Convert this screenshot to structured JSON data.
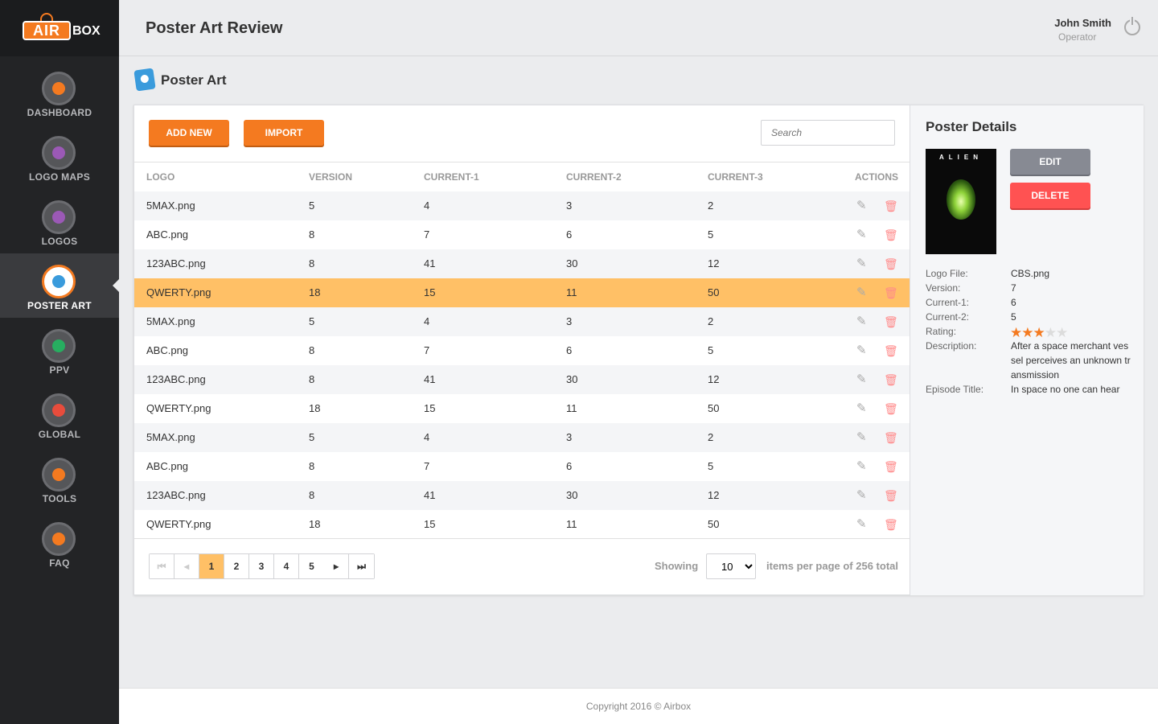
{
  "brand": {
    "air": "AIR",
    "box": "BOX"
  },
  "sidebar": {
    "items": [
      {
        "label": "DASHBOARD",
        "icon": "dashboard-gauge-icon",
        "color": "#f47a20"
      },
      {
        "label": "LOGO MAPS",
        "icon": "map-pin-icon",
        "color": "#9b59b6"
      },
      {
        "label": "LOGOS",
        "icon": "logo-swirl-icon",
        "color": "#9b59b6"
      },
      {
        "label": "POSTER ART",
        "icon": "poster-play-icon",
        "color": "#3a9bdc",
        "active": true
      },
      {
        "label": "PPV",
        "icon": "ppv-dollar-icon",
        "color": "#27ae60"
      },
      {
        "label": "GLOBAL",
        "icon": "global-tv-icon",
        "color": "#e74c3c"
      },
      {
        "label": "TOOLS",
        "icon": "tools-wrench-icon",
        "color": "#f47a20"
      },
      {
        "label": "FAQ",
        "icon": "faq-question-icon",
        "color": "#f47a20"
      }
    ]
  },
  "header": {
    "title": "Poster Art Review",
    "user_name": "John Smith",
    "user_role": "Operator"
  },
  "section": {
    "title": "Poster Art"
  },
  "toolbar": {
    "add_label": "ADD NEW",
    "import_label": "IMPORT",
    "search_placeholder": "Search"
  },
  "table": {
    "columns": [
      "LOGO",
      "VERSION",
      "CURRENT-1",
      "CURRENT-2",
      "CURRENT-3",
      "ACTIONS"
    ],
    "rows": [
      [
        "5MAX.png",
        "5",
        "4",
        "3",
        "2"
      ],
      [
        "ABC.png",
        "8",
        "7",
        "6",
        "5"
      ],
      [
        "123ABC.png",
        "8",
        "41",
        "30",
        "12"
      ],
      [
        "QWERTY.png",
        "18",
        "15",
        "11",
        "50"
      ],
      [
        "5MAX.png",
        "5",
        "4",
        "3",
        "2"
      ],
      [
        "ABC.png",
        "8",
        "7",
        "6",
        "5"
      ],
      [
        "123ABC.png",
        "8",
        "41",
        "30",
        "12"
      ],
      [
        "QWERTY.png",
        "18",
        "15",
        "11",
        "50"
      ],
      [
        "5MAX.png",
        "5",
        "4",
        "3",
        "2"
      ],
      [
        "ABC.png",
        "8",
        "7",
        "6",
        "5"
      ],
      [
        "123ABC.png",
        "8",
        "41",
        "30",
        "12"
      ],
      [
        "QWERTY.png",
        "18",
        "15",
        "11",
        "50"
      ]
    ],
    "selected_row": 3
  },
  "pagination": {
    "pages": [
      "1",
      "2",
      "3",
      "4",
      "5"
    ],
    "current": "1",
    "showing_label": "Showing",
    "per_page": "10",
    "total_label": "items per page of 256 total"
  },
  "details": {
    "title": "Poster Details",
    "poster_title": "ALIEN",
    "edit_label": "EDIT",
    "delete_label": "DELETE",
    "fields": {
      "logo_file_label": "Logo File:",
      "logo_file": "CBS.png",
      "version_label": "Version:",
      "version": "7",
      "current1_label": "Current-1:",
      "current1": "6",
      "current2_label": "Current-2:",
      "current2": "5",
      "rating_label": "Rating:",
      "rating": 3,
      "rating_max": 5,
      "description_label": "Description:",
      "description": "After a space merchant vessel perceives an unknown transmission",
      "episode_label": "Episode Title:",
      "episode": "In space no one can hear"
    }
  },
  "footer": {
    "copyright": "Copyright 2016 © Airbox"
  }
}
